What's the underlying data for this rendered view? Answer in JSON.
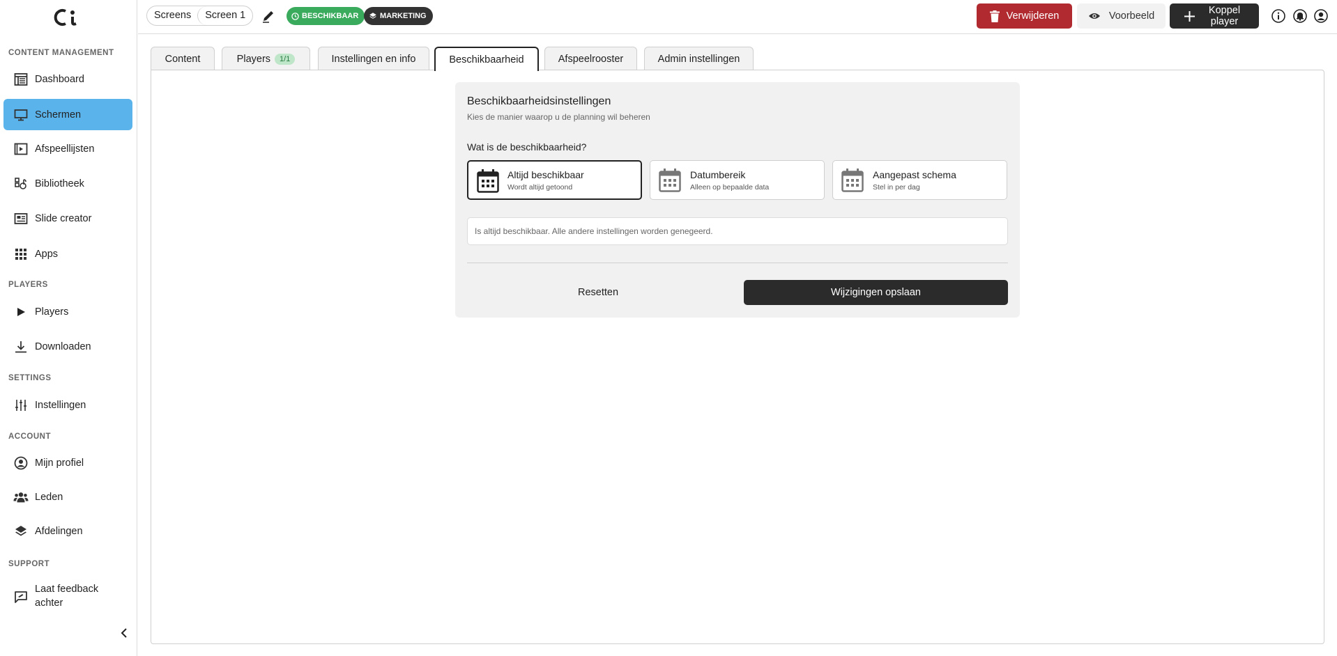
{
  "sidebar": {
    "logo": "ci-logo",
    "sections": {
      "content": "CONTENT MANAGEMENT",
      "players": "PLAYERS",
      "settings": "SETTINGS",
      "account": "ACCOUNT",
      "support": "SUPPORT"
    },
    "items": {
      "dashboard": "Dashboard",
      "schermen": "Schermen",
      "afspeellijsten": "Afspeellijsten",
      "bibliotheek": "Bibliotheek",
      "slide_creator": "Slide creator",
      "apps": "Apps",
      "players": "Players",
      "downloaden": "Downloaden",
      "instellingen": "Instellingen",
      "mijn_profiel": "Mijn profiel",
      "leden": "Leden",
      "afdelingen": "Afdelingen",
      "feedback_line1": "Laat feedback",
      "feedback_line2": "achter"
    },
    "active_item": "Schermen",
    "active_color": "#5bb3ec"
  },
  "header": {
    "breadcrumb": [
      "Screens",
      "Screen 1"
    ],
    "badges": {
      "status": "BESCHIKBAAR",
      "status_color": "#3aaa5c",
      "group": "MARKETING",
      "group_color": "#333333"
    },
    "buttons": {
      "delete": "Verwijderen",
      "delete_color": "#b02a30",
      "preview": "Voorbeeld",
      "add_line1": "Koppel",
      "add_line2": "player"
    },
    "icons": [
      "info-icon",
      "bell-icon",
      "user-icon"
    ]
  },
  "tabs": {
    "content": "Content",
    "players": "Players",
    "players_count": "1/1",
    "instellingen": "Instellingen en info",
    "beschikbaarheid": "Beschikbaarheid",
    "afspeelrooster": "Afspeelrooster",
    "admin": "Admin instellingen",
    "active": "Beschikbaarheid"
  },
  "availability": {
    "title": "Beschikbaarheidsinstellingen",
    "subtitle": "Kies de manier waarop u de planning wil beheren",
    "question": "Wat is de beschikbaarheid?",
    "options": [
      {
        "title": "Altijd beschikbaar",
        "desc": "Wordt altijd getoond",
        "selected": true
      },
      {
        "title": "Datumbereik",
        "desc": "Alleen op bepaalde data",
        "selected": false
      },
      {
        "title": "Aangepast schema",
        "desc": "Stel in per dag",
        "selected": false
      }
    ],
    "info": "Is altijd beschikbaar. Alle andere instellingen worden genegeerd.",
    "reset": "Resetten",
    "save": "Wijzigingen opslaan"
  }
}
